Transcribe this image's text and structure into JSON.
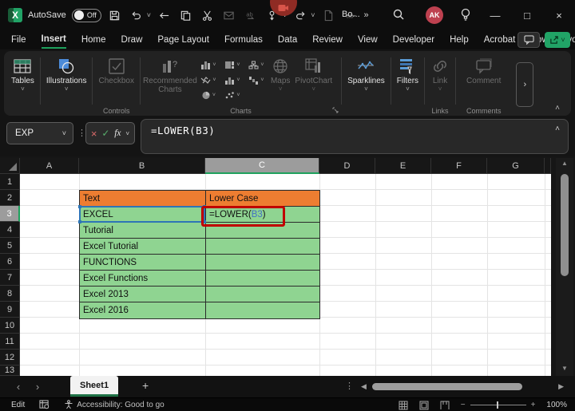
{
  "titlebar": {
    "autosave_label": "AutoSave",
    "autosave_state": "Off",
    "doc_title": "Bo...",
    "avatar_initials": "AK"
  },
  "menu": {
    "tabs": [
      {
        "label": "File"
      },
      {
        "label": "Insert",
        "active": true
      },
      {
        "label": "Home"
      },
      {
        "label": "Draw"
      },
      {
        "label": "Page Layout"
      },
      {
        "label": "Formulas"
      },
      {
        "label": "Data"
      },
      {
        "label": "Review"
      },
      {
        "label": "View"
      },
      {
        "label": "Developer"
      },
      {
        "label": "Help"
      },
      {
        "label": "Acrobat"
      },
      {
        "label": "Power Pivot"
      }
    ]
  },
  "ribbon": {
    "tables_label": "Tables",
    "illustrations_label": "Illustrations",
    "checkbox_label": "Checkbox",
    "recommended_charts_label": "Recommended Charts",
    "maps_label": "Maps",
    "pivotchart_label": "PivotChart",
    "sparklines_label": "Sparklines",
    "filters_label": "Filters",
    "link_label": "Link",
    "comment_label": "Comment",
    "group_controls": "Controls",
    "group_charts": "Charts",
    "group_links": "Links",
    "group_comments": "Comments"
  },
  "formula_bar": {
    "name_box_value": "EXP",
    "fx_label": "fx",
    "formula": "=LOWER(B3)"
  },
  "grid": {
    "col_headers": [
      "A",
      "B",
      "C",
      "D",
      "E",
      "F",
      "G"
    ],
    "row_headers": [
      "1",
      "2",
      "3",
      "4",
      "5",
      "6",
      "7",
      "8",
      "9",
      "10",
      "11",
      "12",
      "13"
    ],
    "selected_cell": "C3",
    "table": {
      "b2": "Text",
      "c2": "Lower Case",
      "b_values": [
        "EXCEL",
        "Tutorial",
        "Excel Tutorial",
        "FUNCTIONS",
        "Excel Functions",
        "Excel 2013",
        "Excel 2016"
      ],
      "c3_prefix": "=LOWER(",
      "c3_ref": "B3",
      "c3_suffix": ")"
    }
  },
  "sheet_bar": {
    "active_tab": "Sheet1"
  },
  "status_bar": {
    "mode": "Edit",
    "accessibility_text": "Accessibility: Good to go",
    "zoom_level": "100%"
  },
  "colors": {
    "accent_green": "#21A366",
    "table_orange": "#ED7D31",
    "table_green": "#8FD491",
    "annotation_red": "#C00000",
    "reference_blue": "#2E75B6"
  },
  "icons": {
    "chevron_down": "˅",
    "chevron_up": "˄",
    "chevron_left": "‹",
    "chevron_right": "›",
    "more": "»",
    "dots_v": "⋮",
    "close": "×",
    "check": "✓",
    "minimize": "—",
    "maximize": "□",
    "plus": "+",
    "tri_left": "◀",
    "tri_right": "▶",
    "tri_up": "▲",
    "tri_down": "▼",
    "minus": "−"
  }
}
